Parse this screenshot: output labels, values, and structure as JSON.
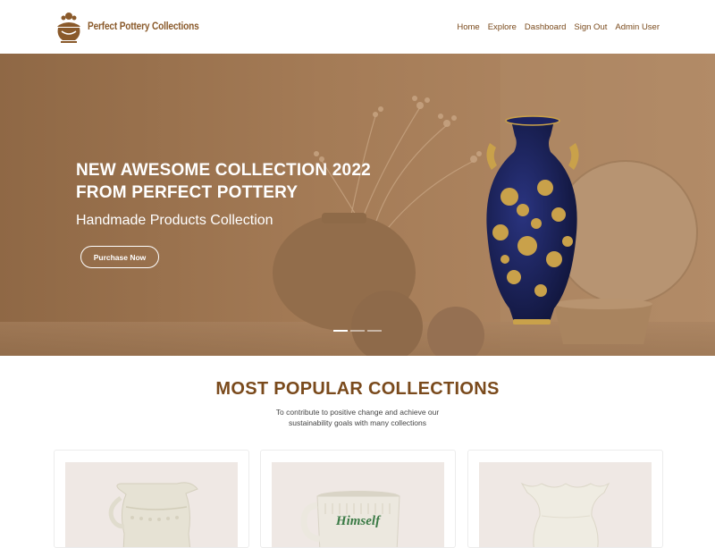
{
  "brand": {
    "name": "Perfect Pottery Collections",
    "logo_icon": "pottery-logo-icon"
  },
  "nav": {
    "items": [
      "Home",
      "Explore",
      "Dashboard",
      "Sign Out",
      "Admin User"
    ]
  },
  "hero": {
    "title_line1": "NEW AWESOME COLLECTION 2022",
    "title_line2": "FROM PERFECT POTTERY",
    "subtitle": "Handmade Products Collection",
    "button_label": "Purchase Now",
    "slides_count": 3,
    "active_slide": 1
  },
  "popular": {
    "title": "MOST POPULAR COLLECTIONS",
    "description": "To contribute to positive change and achieve our sustainability goals with many collections"
  },
  "cards": [
    {
      "icon": "white-pitcher-image"
    },
    {
      "icon": "white-mug-image",
      "label": "Himself"
    },
    {
      "icon": "white-vase-image"
    }
  ],
  "colors": {
    "brand": "#8a5a2b",
    "nav_text": "#7a4a1c",
    "hero_background": "#a47b56",
    "vase_blue": "#1c2260",
    "vase_gold": "#c9a14a",
    "card_background": "#efe8e4"
  }
}
